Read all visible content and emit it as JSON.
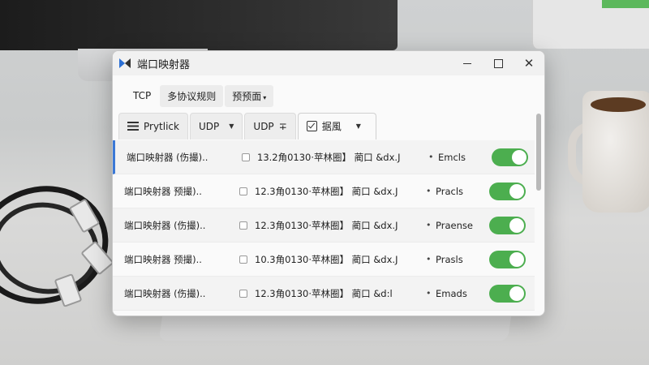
{
  "window": {
    "title": "端口映射器"
  },
  "menu": {
    "tab1": "TCP",
    "tab2": "多协议规则",
    "tab3": "预预面"
  },
  "toolbar": {
    "item1": "Prytlick",
    "item2": "UDP",
    "item3": "UDP",
    "item4": "据風"
  },
  "rows": [
    {
      "name": "端口映射器 (伤撮)..",
      "addr": "13.2角0130·苹林圈】 蔺口 &dx.J",
      "status": "Emcls",
      "enabled": true,
      "selected": true
    },
    {
      "name": "端口映射器 预撮)..",
      "addr": "12.3角0130·苹林圈】 蔺口 &dx.J",
      "status": "Pracls",
      "enabled": true,
      "selected": false
    },
    {
      "name": "端口映射器 (伤撮)..",
      "addr": "12.3角0130·苹林圈】 蔺口 &dx.J",
      "status": "Praense",
      "enabled": true,
      "selected": false
    },
    {
      "name": "端口映射器 预撮)..",
      "addr": "10.3角0130·苹林圈】 蔺口 &dx.J",
      "status": "Prasls",
      "enabled": true,
      "selected": false
    },
    {
      "name": "端口映射器 (伤撮)..",
      "addr": "12.3角0130·苹林圈】 蔺口 &d:l",
      "status": "Emads",
      "enabled": true,
      "selected": false
    }
  ],
  "colors": {
    "accent": "#4cae4f",
    "selection": "#3b78d6"
  }
}
